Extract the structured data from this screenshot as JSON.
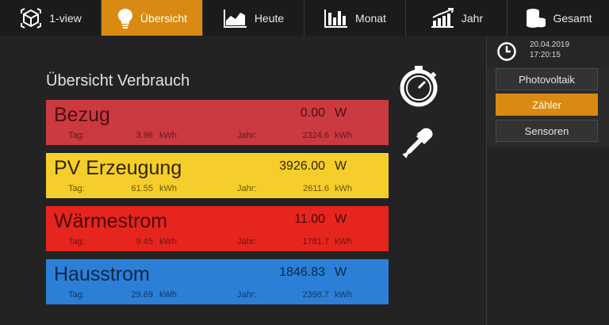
{
  "nav": {
    "tabs": [
      {
        "label": "1-view",
        "icon": "cube-icon"
      },
      {
        "label": "Übersicht",
        "icon": "lightbulb-icon",
        "active": true
      },
      {
        "label": "Heute",
        "icon": "area-chart-icon"
      },
      {
        "label": "Monat",
        "icon": "bar-chart-icon"
      },
      {
        "label": "Jahr",
        "icon": "trend-chart-icon"
      },
      {
        "label": "Gesamt",
        "icon": "coins-icon"
      }
    ]
  },
  "main": {
    "title": "Übersicht Verbrauch",
    "cards": [
      {
        "name": "Bezug",
        "power": "0.00",
        "power_unit": "W",
        "tag_label": "Tag:",
        "tag_value": "3.96",
        "tag_unit": "kWh",
        "jahr_label": "Jahr:",
        "jahr_value": "2324.6",
        "jahr_unit": "kWh",
        "color": "#cb3a40"
      },
      {
        "name": "PV Erzeugung",
        "power": "3926.00",
        "power_unit": "W",
        "tag_label": "Tag:",
        "tag_value": "61.55",
        "tag_unit": "kWh",
        "jahr_label": "Jahr:",
        "jahr_value": "2611.6",
        "jahr_unit": "kWh",
        "color": "#f6ce2b"
      },
      {
        "name": "Wärmestrom",
        "power": "11.00",
        "power_unit": "W",
        "tag_label": "Tag:",
        "tag_value": "9.45",
        "tag_unit": "kWh",
        "jahr_label": "Jahr:",
        "jahr_value": "1781.7",
        "jahr_unit": "kWh",
        "color": "#e6251e"
      },
      {
        "name": "Hausstrom",
        "power": "1846.83",
        "power_unit": "W",
        "tag_label": "Tag:",
        "tag_value": "29.69",
        "tag_unit": "kWh",
        "jahr_label": "Jahr:",
        "jahr_value": "2398.7",
        "jahr_unit": "kWh",
        "color": "#2b7fd6"
      }
    ],
    "tools": [
      {
        "icon": "stopwatch-icon"
      },
      {
        "icon": "pipette-icon"
      }
    ]
  },
  "side": {
    "date": "20.04.2019",
    "time": "17:20:15",
    "buttons": [
      {
        "label": "Photovoltaik"
      },
      {
        "label": "Zähler",
        "active": true
      },
      {
        "label": "Sensoren"
      }
    ]
  },
  "colors": {
    "accent": "#d98a12",
    "background": "#232323",
    "nav_background": "#1b1b1b"
  }
}
